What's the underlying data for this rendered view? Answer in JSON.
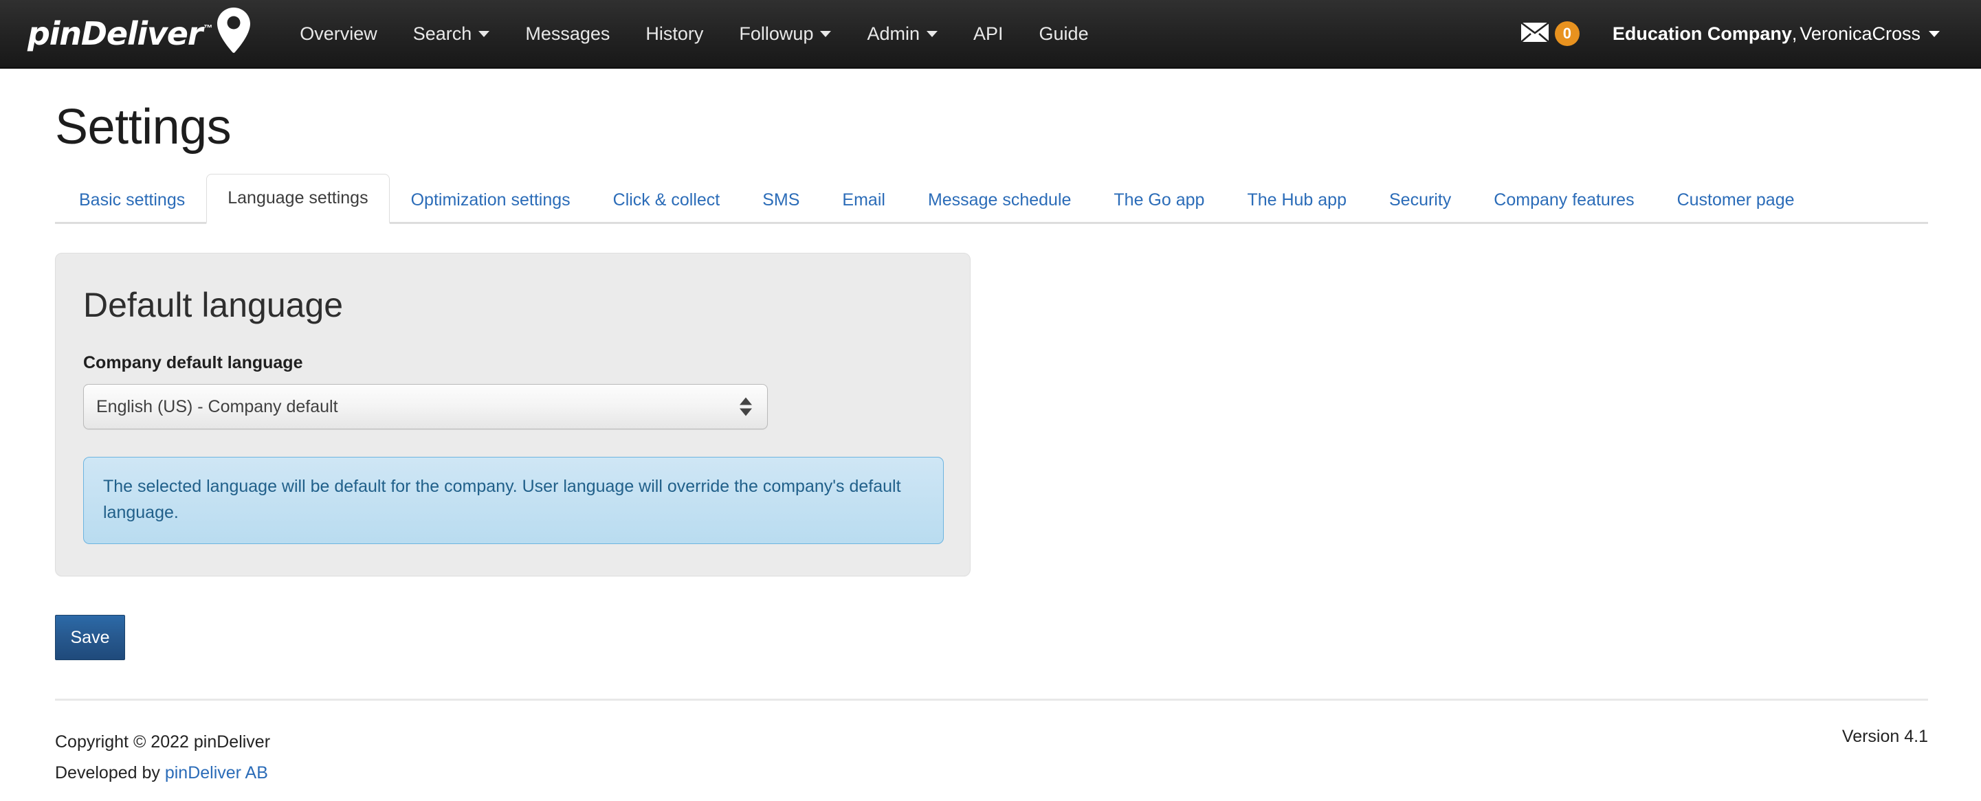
{
  "navbar": {
    "brand": {
      "name": "pinDeliver",
      "tm": "™",
      "icon": "map-pin-icon"
    },
    "links": [
      {
        "label": "Overview",
        "caret": false
      },
      {
        "label": "Search",
        "caret": true
      },
      {
        "label": "Messages",
        "caret": false
      },
      {
        "label": "History",
        "caret": false
      },
      {
        "label": "Followup",
        "caret": true
      },
      {
        "label": "Admin",
        "caret": true
      },
      {
        "label": "API",
        "caret": false
      },
      {
        "label": "Guide",
        "caret": false
      }
    ],
    "messages": {
      "icon": "envelope-icon",
      "badge_count": "0",
      "badge_color": "#e8921f"
    },
    "user": {
      "company": "Education Company",
      "separator": ",",
      "name": "VeronicaCross"
    }
  },
  "page": {
    "title": "Settings"
  },
  "tabs": [
    {
      "label": "Basic settings",
      "active": false
    },
    {
      "label": "Language settings",
      "active": true
    },
    {
      "label": "Optimization settings",
      "active": false
    },
    {
      "label": "Click & collect",
      "active": false
    },
    {
      "label": "SMS",
      "active": false
    },
    {
      "label": "Email",
      "active": false
    },
    {
      "label": "Message schedule",
      "active": false
    },
    {
      "label": "The Go app",
      "active": false
    },
    {
      "label": "The Hub app",
      "active": false
    },
    {
      "label": "Security",
      "active": false
    },
    {
      "label": "Company features",
      "active": false
    },
    {
      "label": "Customer page",
      "active": false
    }
  ],
  "panel": {
    "title": "Default language",
    "field_label": "Company default language",
    "select_value": "English (US) - Company default",
    "select_options": [
      "English (US) - Company default"
    ],
    "alert_text": "The selected language will be default for the company. User language will override the company's default language."
  },
  "actions": {
    "save_label": "Save"
  },
  "footer": {
    "copyright": "Copyright © 2022 pinDeliver",
    "developed_prefix": "Developed by ",
    "developed_link": "pinDeliver AB",
    "version": "Version 4.1"
  },
  "colors": {
    "link_blue": "#2b6cb8",
    "badge_orange": "#e8921f",
    "navbar_dark": "#222222",
    "panel_gray": "#ebebeb",
    "alert_blue_bg": "#b9dcf0",
    "alert_blue_text": "#21608a",
    "save_blue": "#27598f"
  }
}
